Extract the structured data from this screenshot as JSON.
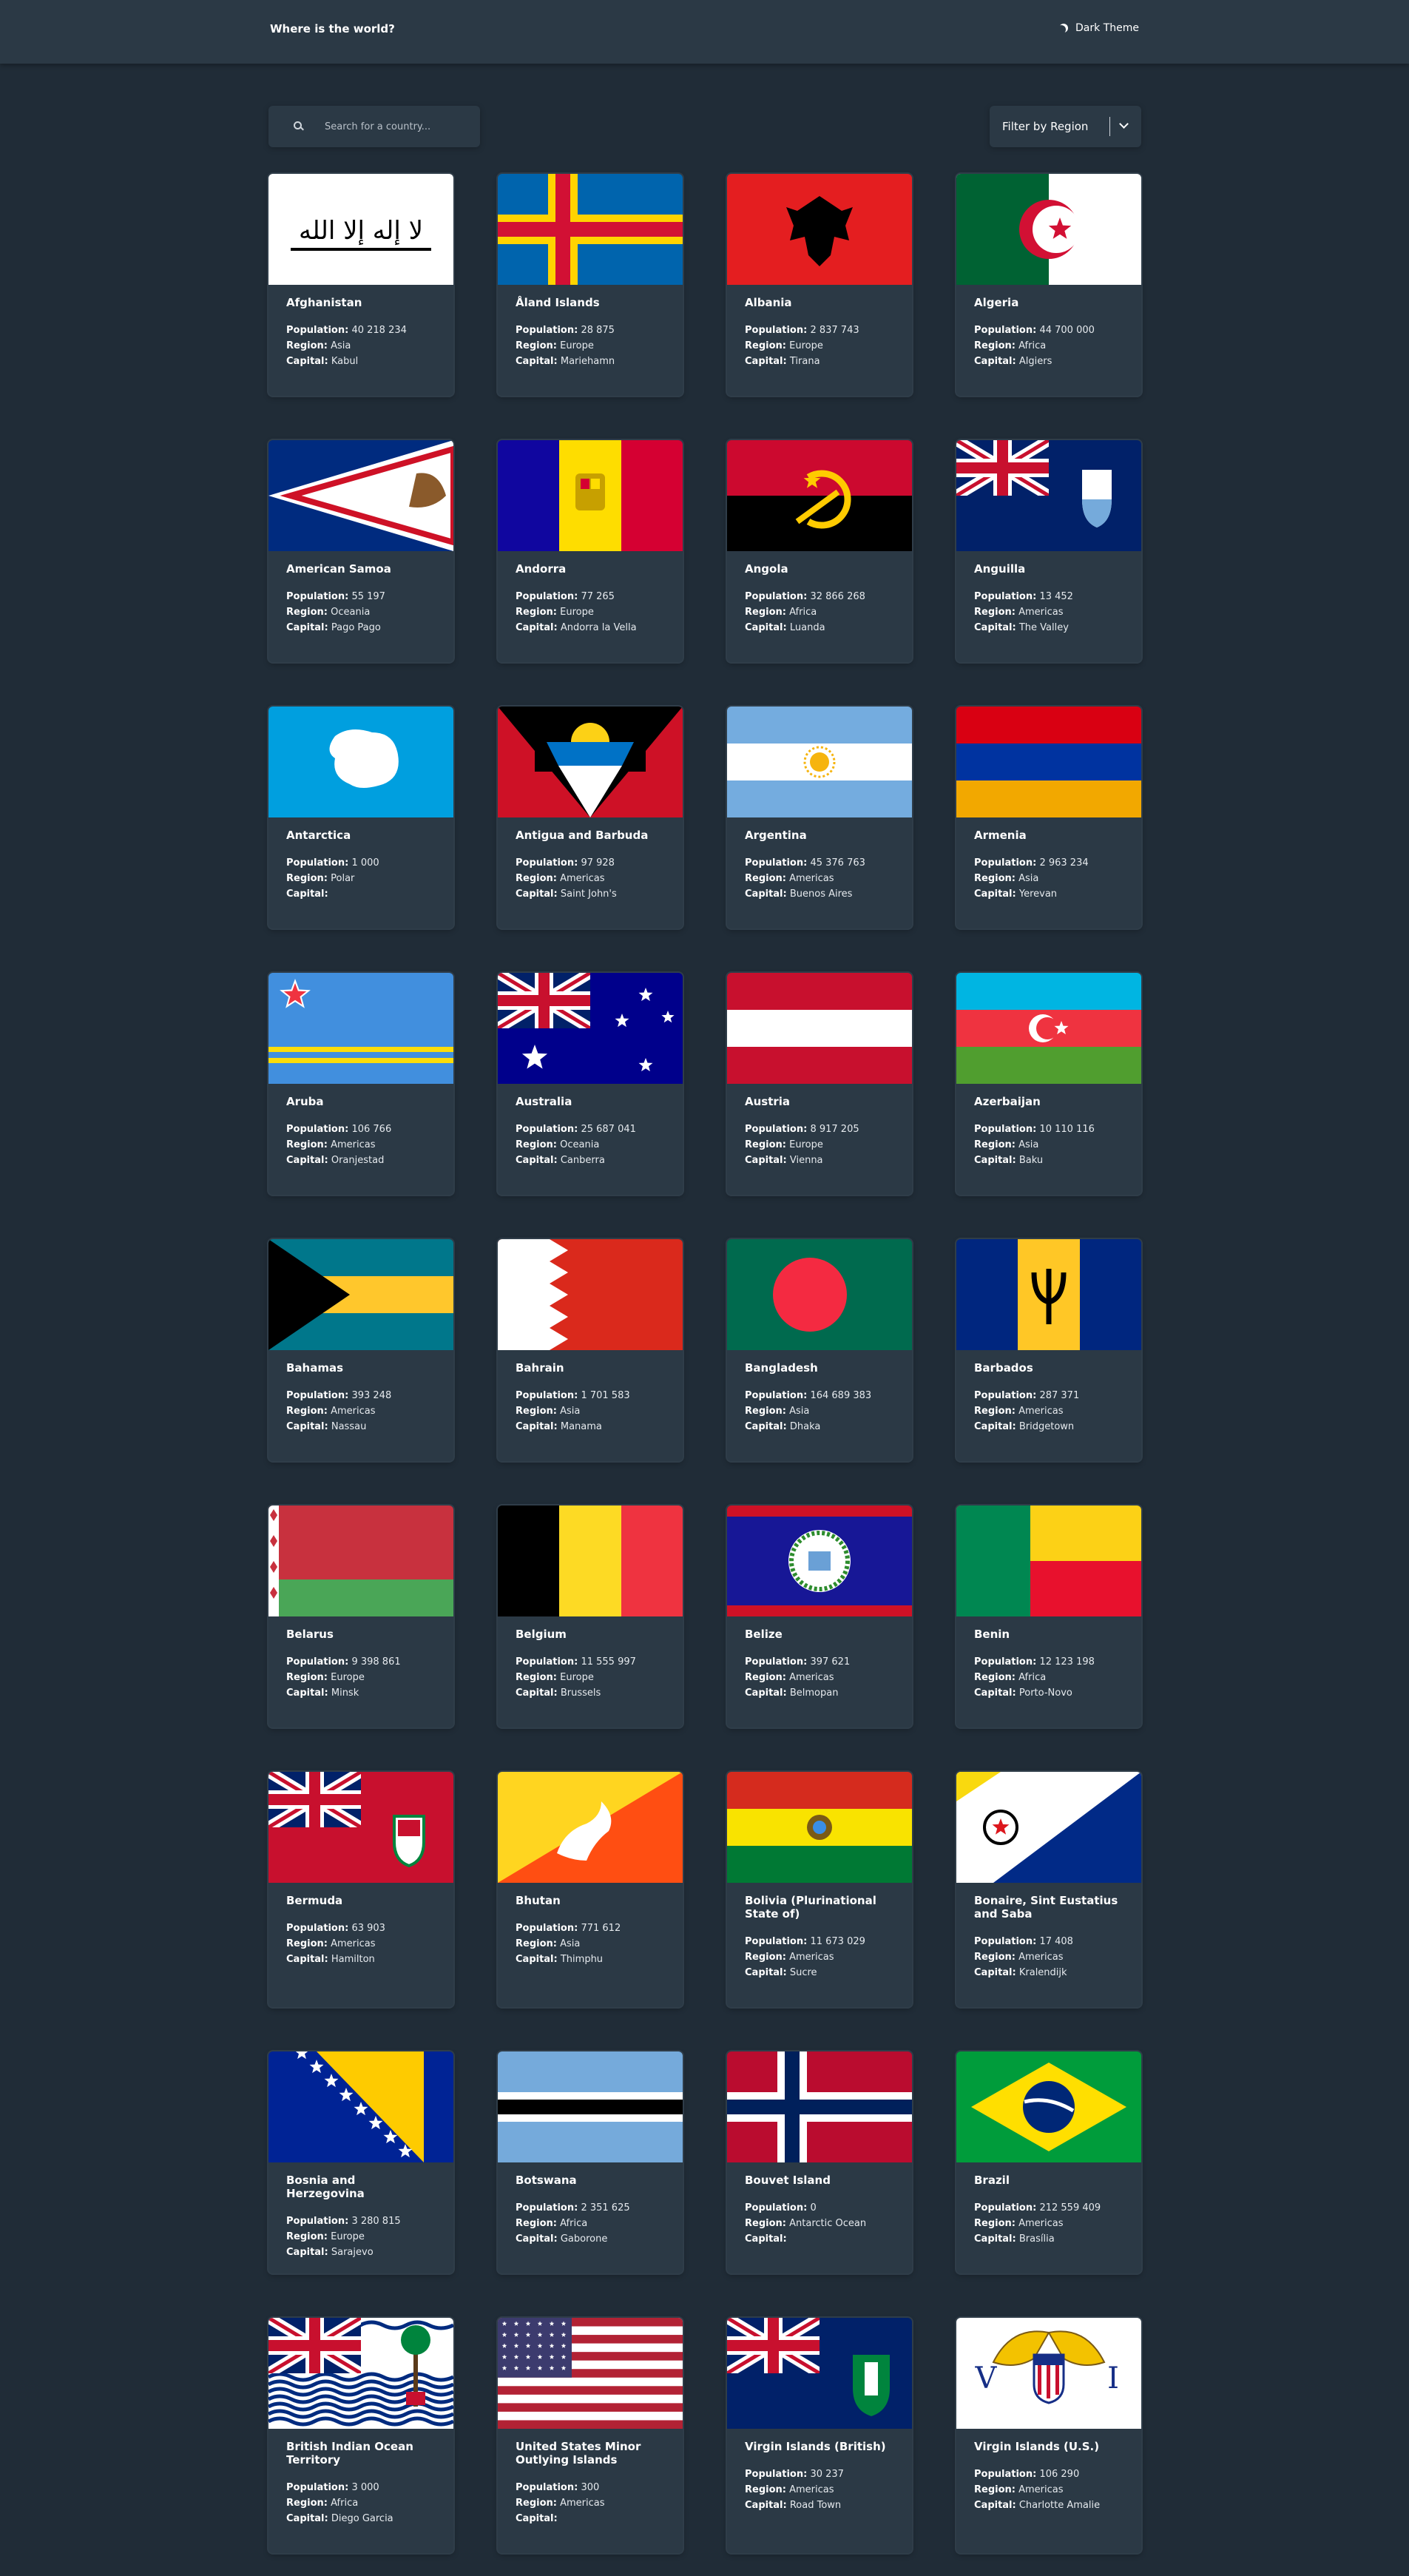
{
  "header": {
    "title": "Where is the world?",
    "theme_label": "Dark Theme"
  },
  "search": {
    "placeholder": "Search for a country..."
  },
  "filter": {
    "label": "Filter by Region"
  },
  "labels": {
    "population": "Population:",
    "region": "Region:",
    "capital": "Capital:"
  },
  "countries": [
    {
      "name": "Afghanistan",
      "population": "40 218 234",
      "region": "Asia",
      "capital": "Kabul"
    },
    {
      "name": "Åland Islands",
      "population": "28 875",
      "region": "Europe",
      "capital": "Mariehamn"
    },
    {
      "name": "Albania",
      "population": "2 837 743",
      "region": "Europe",
      "capital": "Tirana"
    },
    {
      "name": "Algeria",
      "population": "44 700 000",
      "region": "Africa",
      "capital": "Algiers"
    },
    {
      "name": "American Samoa",
      "population": "55 197",
      "region": "Oceania",
      "capital": "Pago Pago"
    },
    {
      "name": "Andorra",
      "population": "77 265",
      "region": "Europe",
      "capital": "Andorra la Vella"
    },
    {
      "name": "Angola",
      "population": "32 866 268",
      "region": "Africa",
      "capital": "Luanda"
    },
    {
      "name": "Anguilla",
      "population": "13 452",
      "region": "Americas",
      "capital": "The Valley"
    },
    {
      "name": "Antarctica",
      "population": "1 000",
      "region": "Polar",
      "capital": ""
    },
    {
      "name": "Antigua and Barbuda",
      "population": "97 928",
      "region": "Americas",
      "capital": "Saint John's"
    },
    {
      "name": "Argentina",
      "population": "45 376 763",
      "region": "Americas",
      "capital": "Buenos Aires"
    },
    {
      "name": "Armenia",
      "population": "2 963 234",
      "region": "Asia",
      "capital": "Yerevan"
    },
    {
      "name": "Aruba",
      "population": "106 766",
      "region": "Americas",
      "capital": "Oranjestad"
    },
    {
      "name": "Australia",
      "population": "25 687 041",
      "region": "Oceania",
      "capital": "Canberra"
    },
    {
      "name": "Austria",
      "population": "8 917 205",
      "region": "Europe",
      "capital": "Vienna"
    },
    {
      "name": "Azerbaijan",
      "population": "10 110 116",
      "region": "Asia",
      "capital": "Baku"
    },
    {
      "name": "Bahamas",
      "population": "393 248",
      "region": "Americas",
      "capital": "Nassau"
    },
    {
      "name": "Bahrain",
      "population": "1 701 583",
      "region": "Asia",
      "capital": "Manama"
    },
    {
      "name": "Bangladesh",
      "population": "164 689 383",
      "region": "Asia",
      "capital": "Dhaka"
    },
    {
      "name": "Barbados",
      "population": "287 371",
      "region": "Americas",
      "capital": "Bridgetown"
    },
    {
      "name": "Belarus",
      "population": "9 398 861",
      "region": "Europe",
      "capital": "Minsk"
    },
    {
      "name": "Belgium",
      "population": "11 555 997",
      "region": "Europe",
      "capital": "Brussels"
    },
    {
      "name": "Belize",
      "population": "397 621",
      "region": "Americas",
      "capital": "Belmopan"
    },
    {
      "name": "Benin",
      "population": "12 123 198",
      "region": "Africa",
      "capital": "Porto-Novo"
    },
    {
      "name": "Bermuda",
      "population": "63 903",
      "region": "Americas",
      "capital": "Hamilton"
    },
    {
      "name": "Bhutan",
      "population": "771 612",
      "region": "Asia",
      "capital": "Thimphu"
    },
    {
      "name": "Bolivia (Plurinational State of)",
      "population": "11 673 029",
      "region": "Americas",
      "capital": "Sucre"
    },
    {
      "name": "Bonaire, Sint Eustatius and Saba",
      "population": "17 408",
      "region": "Americas",
      "capital": "Kralendijk"
    },
    {
      "name": "Bosnia and Herzegovina",
      "population": "3 280 815",
      "region": "Europe",
      "capital": "Sarajevo"
    },
    {
      "name": "Botswana",
      "population": "2 351 625",
      "region": "Africa",
      "capital": "Gaborone"
    },
    {
      "name": "Bouvet Island",
      "population": "0",
      "region": "Antarctic Ocean",
      "capital": ""
    },
    {
      "name": "Brazil",
      "population": "212 559 409",
      "region": "Americas",
      "capital": "Brasília"
    },
    {
      "name": "British Indian Ocean Territory",
      "population": "3 000",
      "region": "Africa",
      "capital": "Diego Garcia"
    },
    {
      "name": "United States Minor Outlying Islands",
      "population": "300",
      "region": "Americas",
      "capital": ""
    },
    {
      "name": "Virgin Islands (British)",
      "population": "30 237",
      "region": "Americas",
      "capital": "Road Town"
    },
    {
      "name": "Virgin Islands (U.S.)",
      "population": "106 290",
      "region": "Americas",
      "capital": "Charlotte Amalie"
    }
  ]
}
